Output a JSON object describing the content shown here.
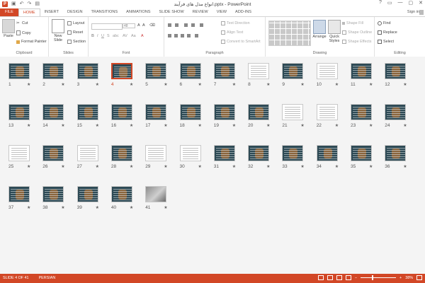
{
  "titlebar": {
    "app_icon_label": "P",
    "title": "انواع مدل های فرآیند.pptx - PowerPoint",
    "qat": [
      "save",
      "undo",
      "redo",
      "present"
    ],
    "controls": [
      "?",
      "▭",
      "—",
      "▢",
      "✕"
    ]
  },
  "tabs": [
    "FILE",
    "HOME",
    "INSERT",
    "DESIGN",
    "TRANSITIONS",
    "ANIMATIONS",
    "SLIDE SHOW",
    "REVIEW",
    "VIEW",
    "ADD-INS"
  ],
  "active_tab": "HOME",
  "signin": "Sign in",
  "ribbon": {
    "clipboard": {
      "label": "Clipboard",
      "paste": "Paste",
      "cut": "Cut",
      "copy": "Copy",
      "format_painter": "Format Painter"
    },
    "slides": {
      "label": "Slides",
      "new_slide": "New",
      "new_slide_2": "Slide",
      "layout": "Layout",
      "reset": "Reset",
      "section": "Section"
    },
    "font": {
      "label": "Font",
      "size_value": "48"
    },
    "paragraph": {
      "label": "Paragraph",
      "text_direction": "Text Direction",
      "align_text": "Align Text",
      "convert_smartart": "Convert to SmartArt"
    },
    "drawing": {
      "label": "Drawing",
      "arrange": "Arrange",
      "quick_styles": "Quick",
      "quick_styles_2": "Styles",
      "shape_fill": "Shape Fill",
      "shape_outline": "Shape Outline",
      "shape_effects": "Shape Effects"
    },
    "editing": {
      "label": "Editing",
      "find": "Find",
      "replace": "Replace",
      "select": "Select"
    }
  },
  "slides": [
    {
      "n": "1",
      "t": "dark"
    },
    {
      "n": "2",
      "t": "dark"
    },
    {
      "n": "3",
      "t": "dark"
    },
    {
      "n": "4",
      "t": "dark",
      "sel": true
    },
    {
      "n": "5",
      "t": "dark"
    },
    {
      "n": "6",
      "t": "dark"
    },
    {
      "n": "7",
      "t": "dark"
    },
    {
      "n": "8",
      "t": "white"
    },
    {
      "n": "9",
      "t": "dark"
    },
    {
      "n": "10",
      "t": "white"
    },
    {
      "n": "11",
      "t": "dark"
    },
    {
      "n": "12",
      "t": "dark"
    },
    {
      "n": "13",
      "t": "dark"
    },
    {
      "n": "14",
      "t": "dark"
    },
    {
      "n": "15",
      "t": "dark"
    },
    {
      "n": "16",
      "t": "dark"
    },
    {
      "n": "17",
      "t": "dark"
    },
    {
      "n": "18",
      "t": "dark"
    },
    {
      "n": "19",
      "t": "dark"
    },
    {
      "n": "20",
      "t": "dark"
    },
    {
      "n": "21",
      "t": "white"
    },
    {
      "n": "22",
      "t": "white"
    },
    {
      "n": "23",
      "t": "dark"
    },
    {
      "n": "24",
      "t": "dark"
    },
    {
      "n": "25",
      "t": "white"
    },
    {
      "n": "26",
      "t": "dark"
    },
    {
      "n": "27",
      "t": "white"
    },
    {
      "n": "28",
      "t": "dark"
    },
    {
      "n": "29",
      "t": "white"
    },
    {
      "n": "30",
      "t": "white"
    },
    {
      "n": "31",
      "t": "dark"
    },
    {
      "n": "32",
      "t": "dark"
    },
    {
      "n": "33",
      "t": "dark"
    },
    {
      "n": "34",
      "t": "dark"
    },
    {
      "n": "35",
      "t": "dark"
    },
    {
      "n": "36",
      "t": "dark"
    },
    {
      "n": "37",
      "t": "dark"
    },
    {
      "n": "38",
      "t": "dark"
    },
    {
      "n": "39",
      "t": "dark"
    },
    {
      "n": "40",
      "t": "dark"
    },
    {
      "n": "41",
      "t": "photo"
    }
  ],
  "star": "★",
  "status": {
    "slide": "SLIDE 4 OF 41",
    "language": "PERSIAN",
    "zoom": "38%"
  },
  "colors": {
    "accent": "#d24726"
  }
}
